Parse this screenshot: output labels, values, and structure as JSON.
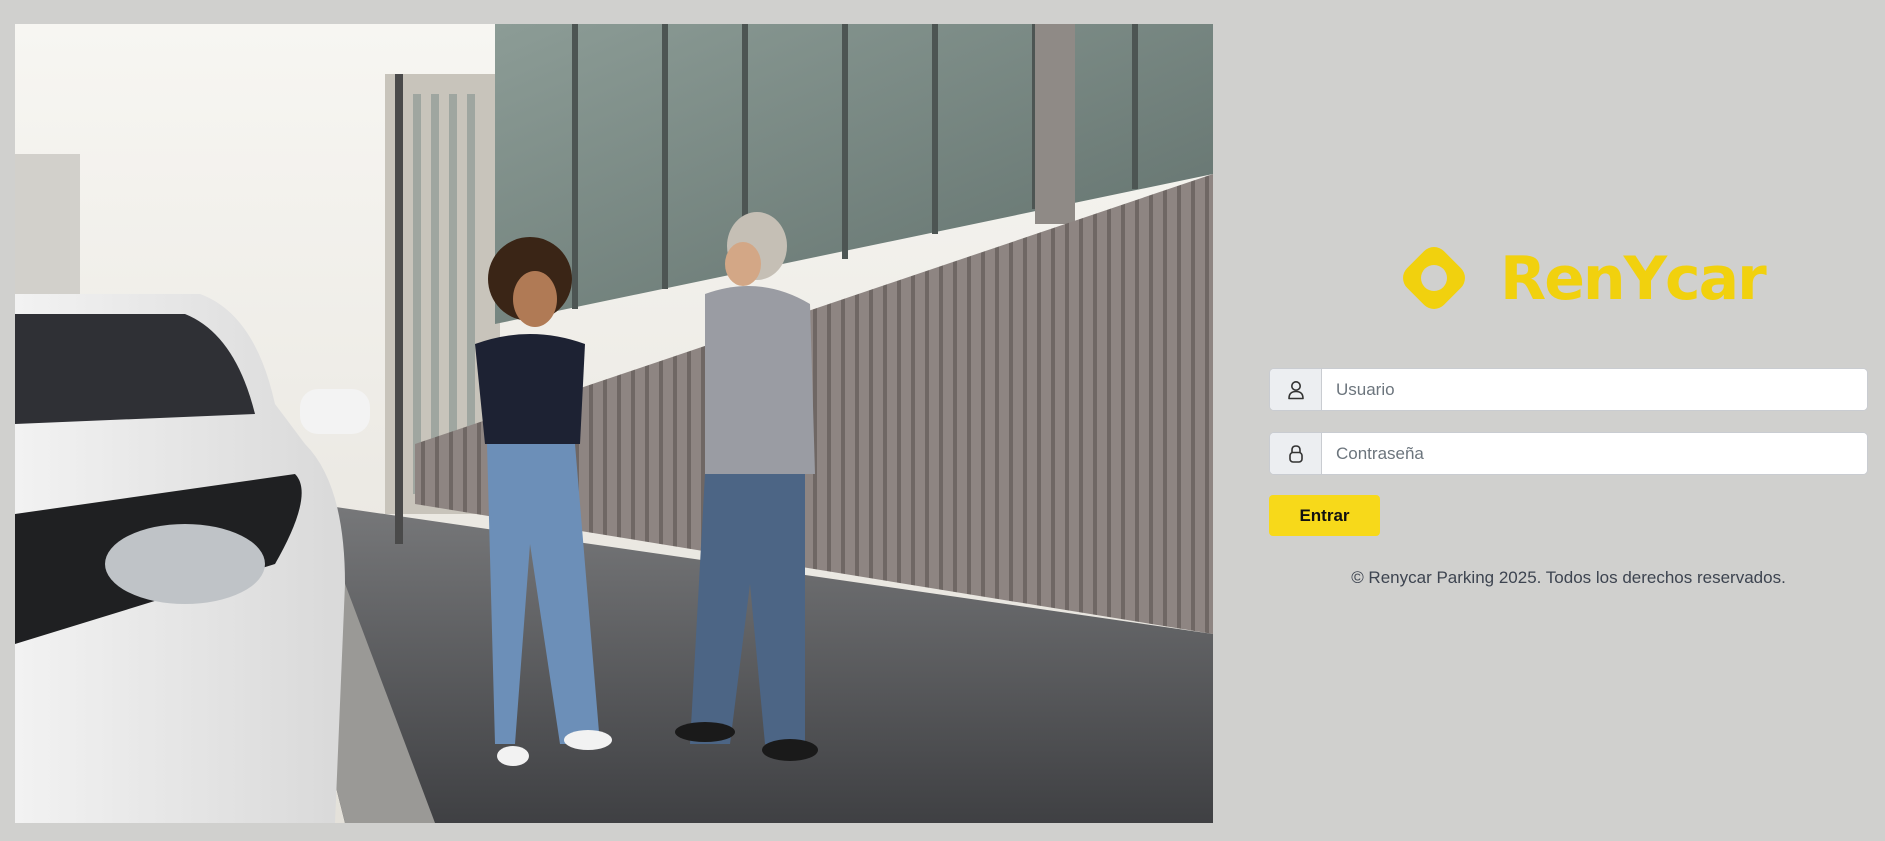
{
  "brand": {
    "name": "RenYcar",
    "color": "#f1d10e",
    "logo_icon": "rounded-diamond-icon"
  },
  "hero": {
    "description_icon": "hero-photo"
  },
  "login": {
    "username": {
      "placeholder": "Usuario",
      "value": "",
      "icon": "user-icon"
    },
    "password": {
      "placeholder": "Contraseña",
      "value": "",
      "icon": "lock-icon"
    },
    "submit_label": "Entrar",
    "button_color": "#f7d91a"
  },
  "footer": {
    "text": "© Renycar Parking 2025. Todos los derechos reservados."
  },
  "colors": {
    "background": "#d0d0ce",
    "input_border": "#c9ccd1",
    "addon_background": "#eceef1"
  }
}
